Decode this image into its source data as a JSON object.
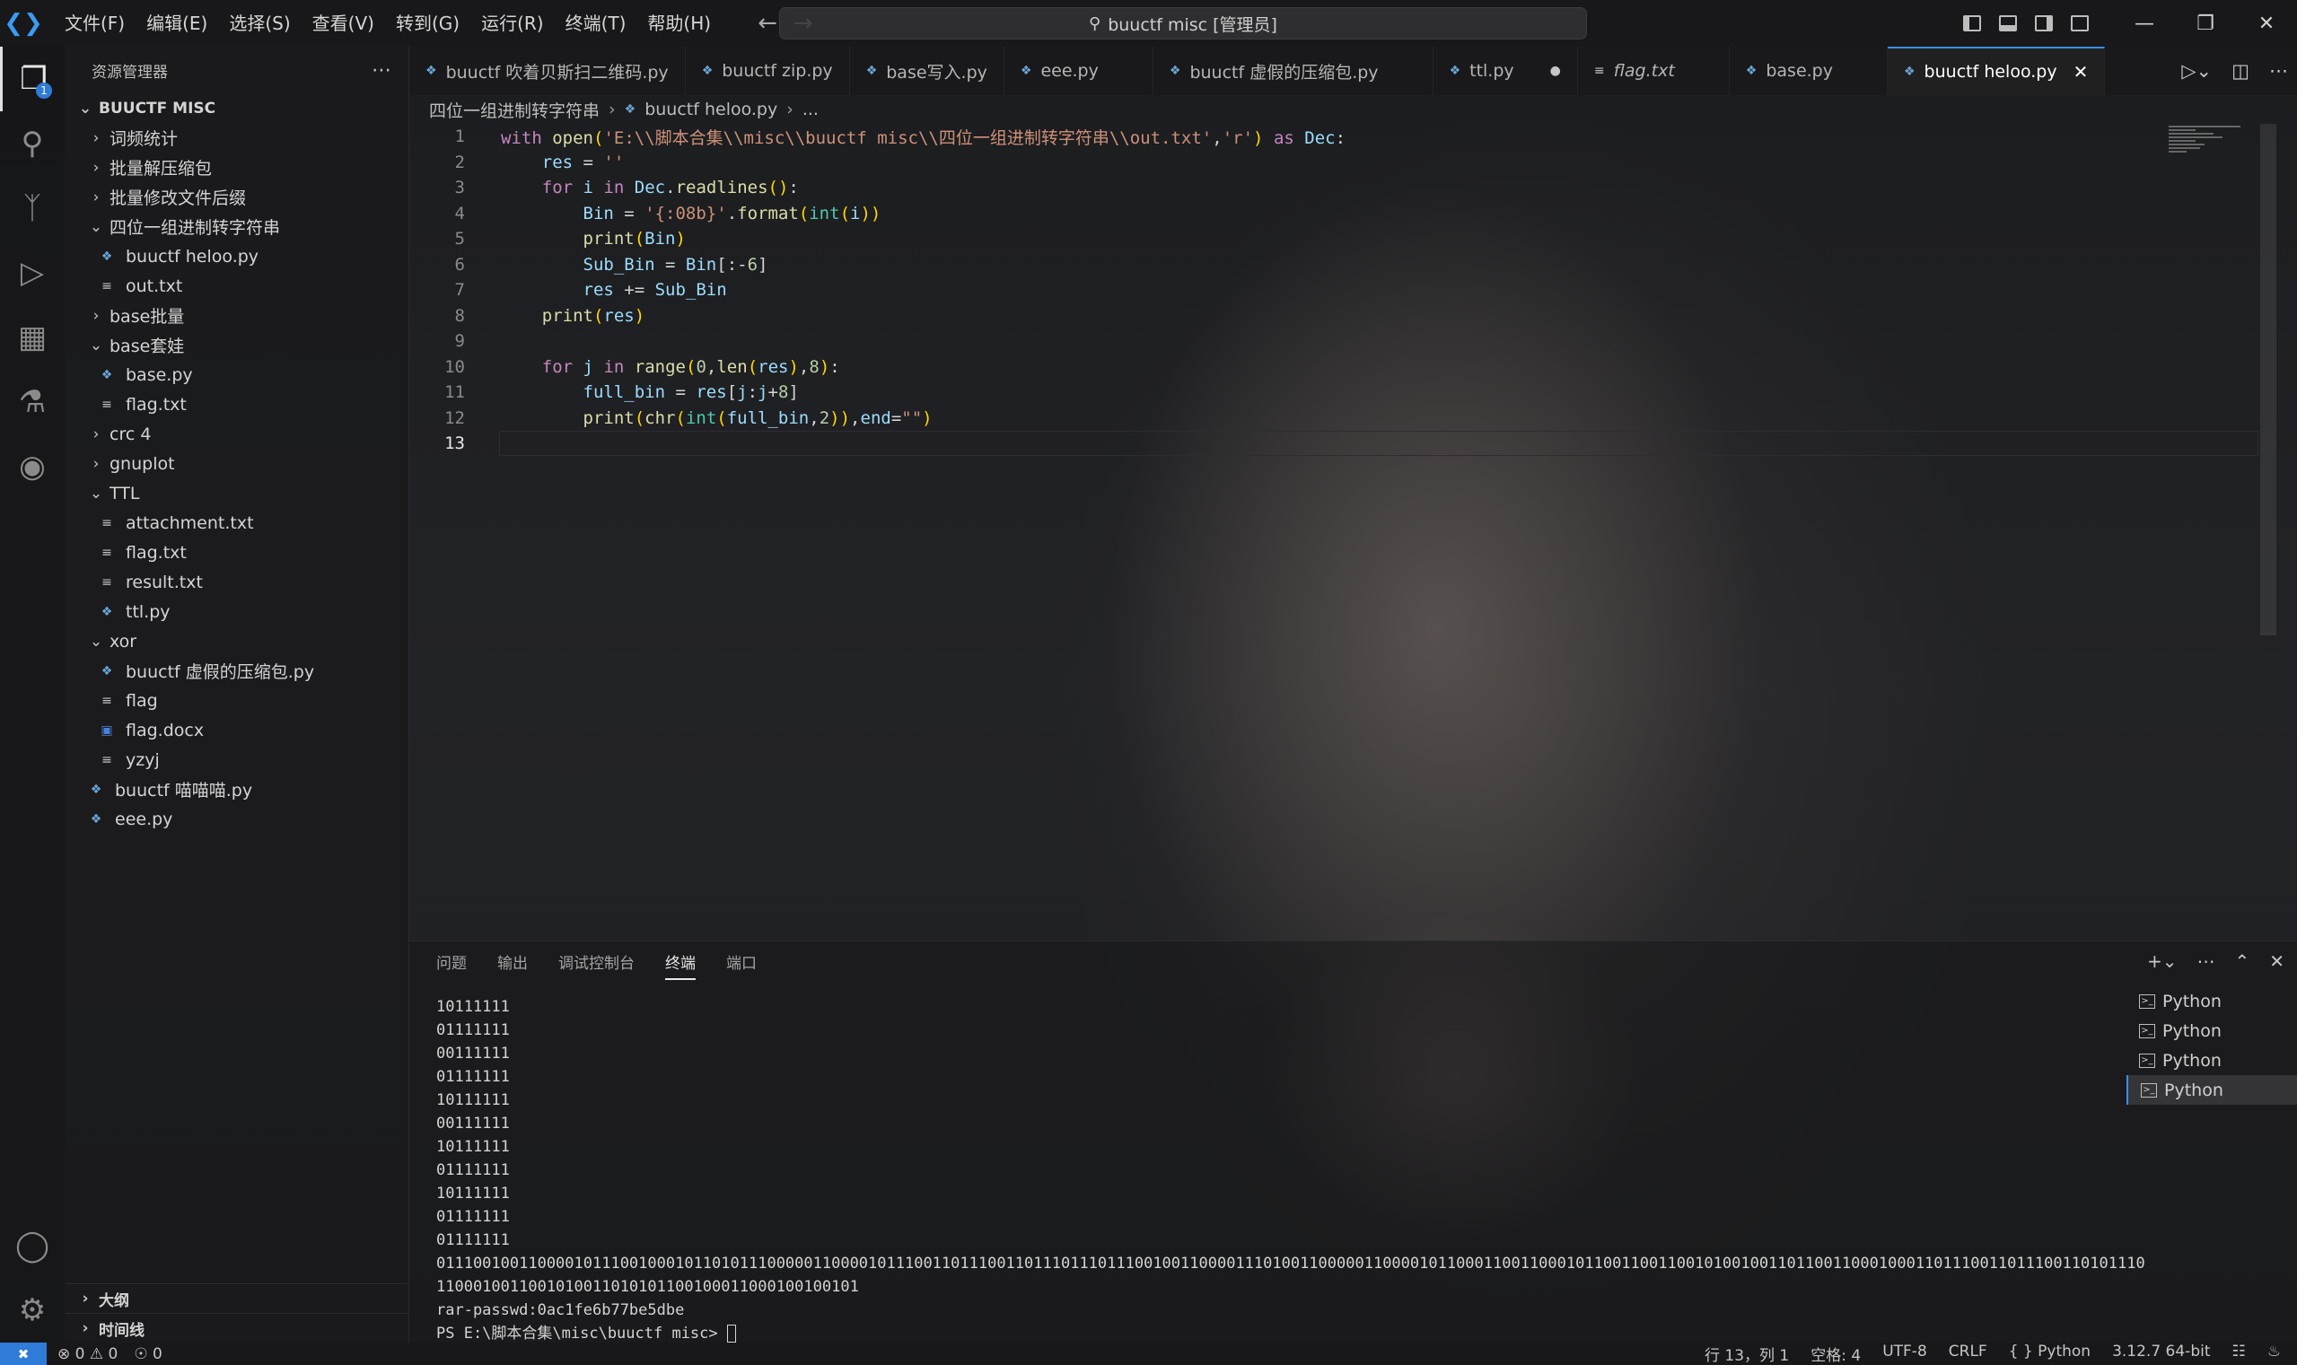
{
  "titlebar": {
    "menu": [
      "文件(F)",
      "编辑(E)",
      "选择(S)",
      "查看(V)",
      "转到(G)",
      "运行(R)",
      "终端(T)",
      "帮助(H)"
    ],
    "command_center": "buuctf misc [管理员]"
  },
  "activity": {
    "explorer_badge": "1"
  },
  "sidebar": {
    "title": "资源管理器",
    "root": "BUUCTF MISC",
    "tree": [
      {
        "label": "词频统计",
        "type": "folder",
        "expanded": false,
        "depth": 1
      },
      {
        "label": "批量解压缩包",
        "type": "folder",
        "expanded": false,
        "depth": 1
      },
      {
        "label": "批量修改文件后缀",
        "type": "folder",
        "expanded": false,
        "depth": 1
      },
      {
        "label": "四位一组进制转字符串",
        "type": "folder",
        "expanded": true,
        "depth": 1
      },
      {
        "label": "buuctf heloo.py",
        "type": "py",
        "depth": 2
      },
      {
        "label": "out.txt",
        "type": "txt",
        "depth": 2
      },
      {
        "label": "base批量",
        "type": "folder",
        "expanded": false,
        "depth": 1
      },
      {
        "label": "base套娃",
        "type": "folder",
        "expanded": true,
        "depth": 1
      },
      {
        "label": "base.py",
        "type": "py",
        "depth": 2
      },
      {
        "label": "flag.txt",
        "type": "txt",
        "depth": 2
      },
      {
        "label": "crc 4",
        "type": "folder",
        "expanded": false,
        "depth": 1
      },
      {
        "label": "gnuplot",
        "type": "folder",
        "expanded": false,
        "depth": 1
      },
      {
        "label": "TTL",
        "type": "folder",
        "expanded": true,
        "depth": 1
      },
      {
        "label": "attachment.txt",
        "type": "txt",
        "depth": 2
      },
      {
        "label": "flag.txt",
        "type": "txt",
        "depth": 2
      },
      {
        "label": "result.txt",
        "type": "txt",
        "depth": 2
      },
      {
        "label": "ttl.py",
        "type": "py",
        "depth": 2
      },
      {
        "label": "xor",
        "type": "folder",
        "expanded": true,
        "depth": 1
      },
      {
        "label": "buuctf 虚假的压缩包.py",
        "type": "py",
        "depth": 2
      },
      {
        "label": "flag",
        "type": "txt",
        "depth": 2
      },
      {
        "label": "flag.docx",
        "type": "doc",
        "depth": 2
      },
      {
        "label": "yzyj",
        "type": "txt",
        "depth": 2
      },
      {
        "label": "buuctf 喵喵喵.py",
        "type": "py",
        "depth": 1
      },
      {
        "label": "eee.py",
        "type": "py",
        "depth": 1
      }
    ],
    "outline": "大纲",
    "timeline": "时间线"
  },
  "tabs": [
    {
      "label": "buuctf 吹着贝斯扫二维码.py",
      "italic": false,
      "active": false
    },
    {
      "label": "buuctf zip.py",
      "italic": false,
      "active": false
    },
    {
      "label": "base写入.py",
      "italic": false,
      "active": false
    },
    {
      "label": "eee.py",
      "italic": false,
      "active": false
    },
    {
      "label": "buuctf 虚假的压缩包.py",
      "italic": false,
      "active": false
    },
    {
      "label": "ttl.py",
      "italic": false,
      "active": false
    },
    {
      "label": "flag.txt",
      "italic": true,
      "active": false
    },
    {
      "label": "base.py",
      "italic": false,
      "active": false
    },
    {
      "label": "buuctf heloo.py",
      "italic": false,
      "active": true
    }
  ],
  "breadcrumb": [
    "四位一组进制转字符串",
    "buuctf heloo.py",
    "..."
  ],
  "editor": {
    "line_numbers": [
      "1",
      "2",
      "3",
      "4",
      "5",
      "6",
      "7",
      "8",
      "9",
      "10",
      "11",
      "12",
      "13"
    ],
    "current_line": "13"
  },
  "panel": {
    "tabs": [
      "问题",
      "输出",
      "调试控制台",
      "终端",
      "端口"
    ],
    "active_tab": "终端",
    "terminal_lines": [
      "10111111",
      "01111111",
      "00111111",
      "01111111",
      "10111111",
      "00111111",
      "10111111",
      "01111111",
      "10111111",
      "01111111",
      "01111111",
      "011100100110000101110010001011010111000001100001011100110111001101110111011100100110000111010011000001100001011000110011000101100110011001010010011011001100010001101110011011100110101110",
      "1100010011001010011010101100100011000100100101",
      "rar-passwd:0ac1fe6b77be5dbe",
      "PS E:\\脚本合集\\misc\\buuctf misc> "
    ],
    "terminals": [
      "Python",
      "Python",
      "Python",
      "Python"
    ]
  },
  "statusbar": {
    "errors": "0",
    "warnings": "0",
    "ports": "0",
    "position": "行 13，列 1",
    "spaces": "空格: 4",
    "encoding": "UTF-8",
    "eol": "CRLF",
    "language": "{ } Python",
    "interpreter": "3.12.7 64-bit"
  }
}
